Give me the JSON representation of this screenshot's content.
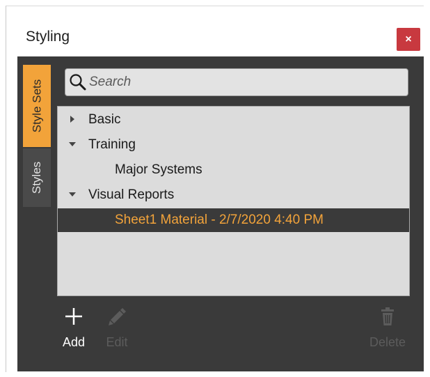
{
  "window": {
    "title": "Styling",
    "close_label": "×"
  },
  "side_tabs": [
    {
      "label": "Style Sets",
      "active": true
    },
    {
      "label": "Styles",
      "active": false
    }
  ],
  "search": {
    "placeholder": "Search",
    "value": ""
  },
  "tree": {
    "items": [
      {
        "label": "Basic",
        "expanded": false,
        "level": 0
      },
      {
        "label": "Training",
        "expanded": true,
        "level": 0
      },
      {
        "label": "Major Systems",
        "level": 1
      },
      {
        "label": "Visual Reports",
        "expanded": true,
        "level": 0
      },
      {
        "label": "Sheet1 Material - 2/7/2020 4:40 PM",
        "level": 1,
        "selected": true
      }
    ]
  },
  "toolbar": {
    "add_label": "Add",
    "edit_label": "Edit",
    "delete_label": "Delete"
  },
  "colors": {
    "accent": "#f2a33a",
    "panel": "#3a3a3a",
    "close": "#c8393f"
  }
}
